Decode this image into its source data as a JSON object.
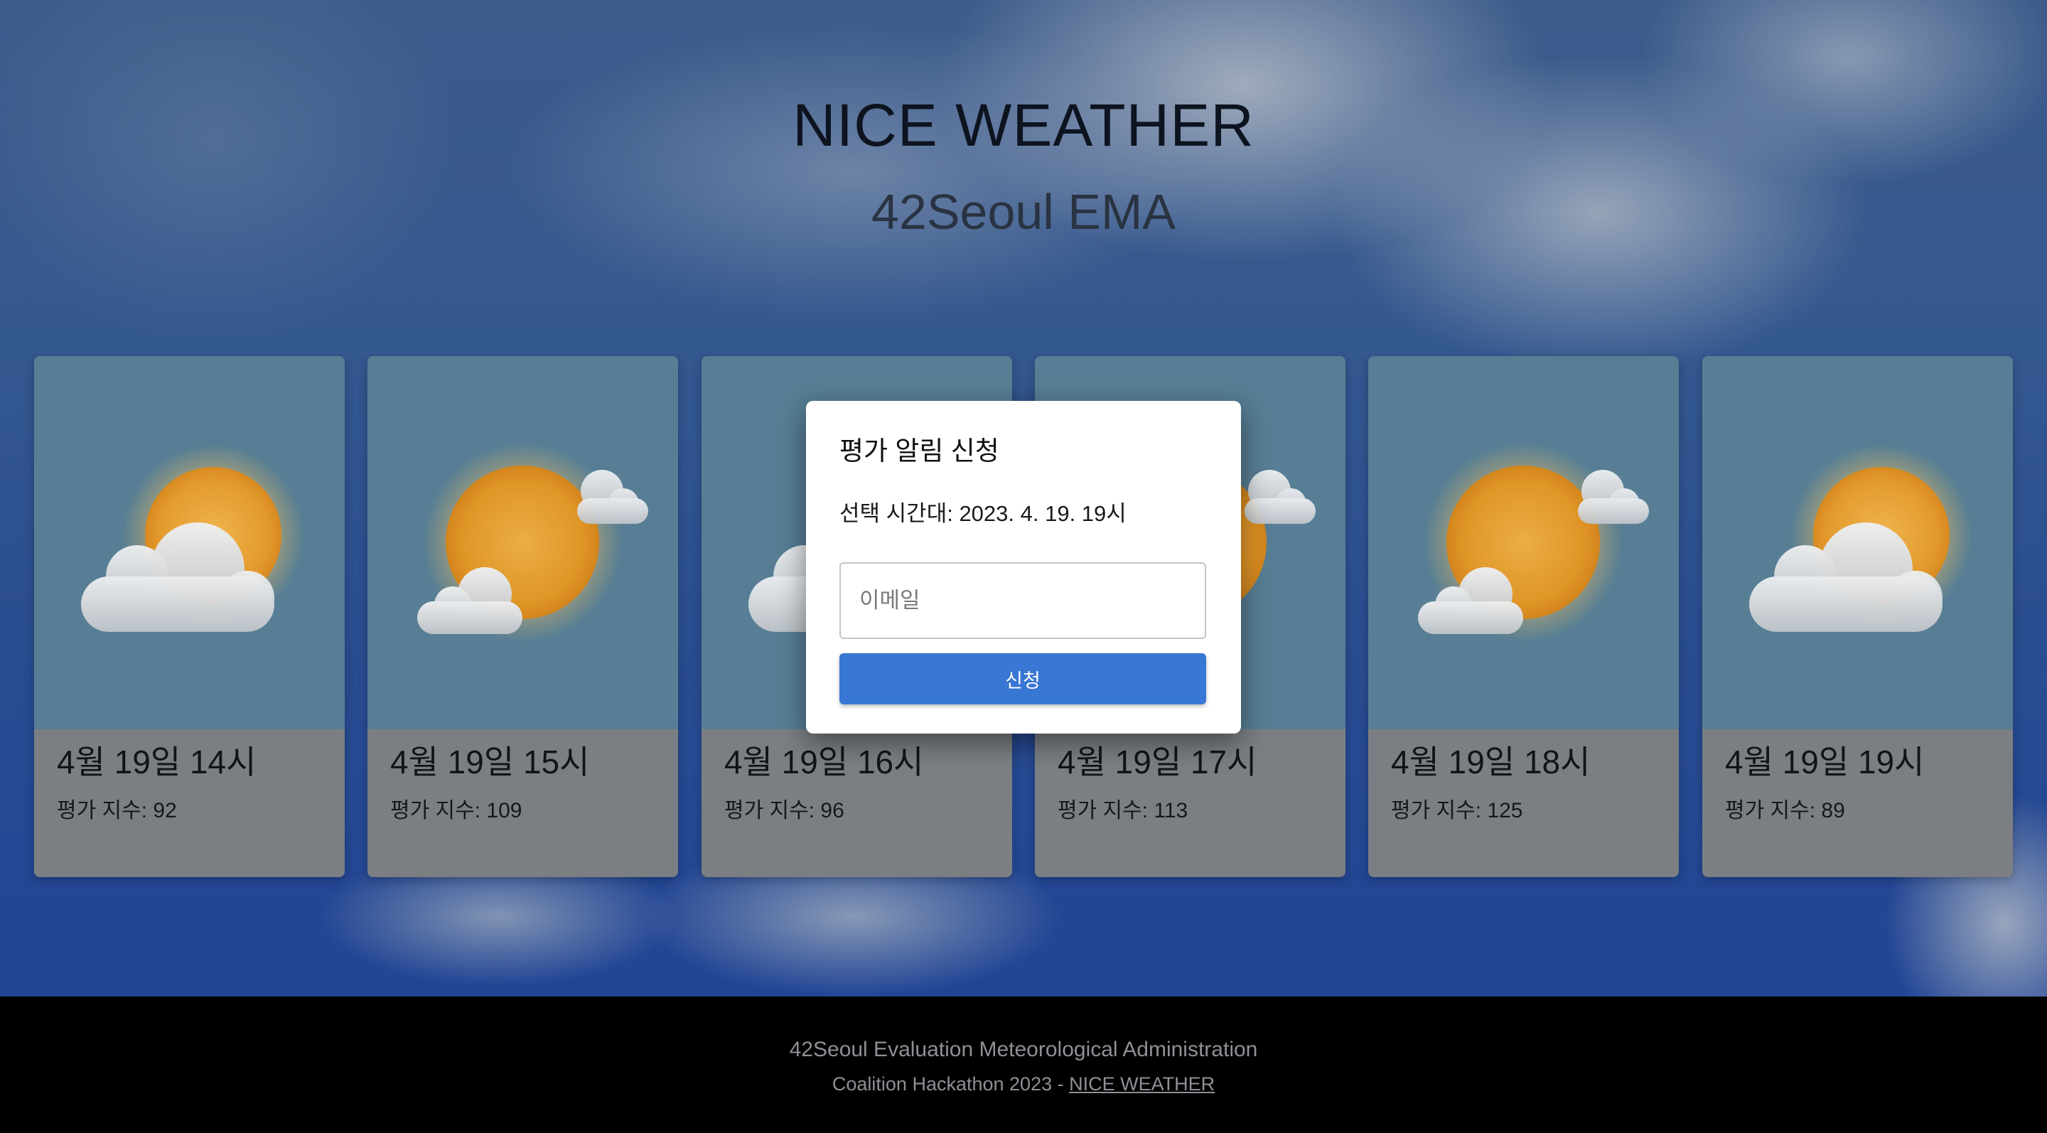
{
  "header": {
    "title": "NICE WEATHER",
    "subtitle": "42Seoul EMA"
  },
  "cards": [
    {
      "time": "4월 19일 14시",
      "score": "평가 지수: 92",
      "icon": "sun-behind-large-cloud-icon"
    },
    {
      "time": "4월 19일 15시",
      "score": "평가 지수: 109",
      "icon": "sun-behind-small-cloud-icon"
    },
    {
      "time": "4월 19일 16시",
      "score": "평가 지수: 96",
      "icon": "sun-behind-large-cloud-icon"
    },
    {
      "time": "4월 19일 17시",
      "score": "평가 지수: 113",
      "icon": "sun-behind-small-cloud-icon"
    },
    {
      "time": "4월 19일 18시",
      "score": "평가 지수: 125",
      "icon": "sun-behind-small-cloud-icon"
    },
    {
      "time": "4월 19일 19시",
      "score": "평가 지수: 89",
      "icon": "sun-behind-large-cloud-icon"
    }
  ],
  "modal": {
    "title": "평가 알림 신청",
    "selected_time": "선택 시간대: 2023. 4. 19. 19시",
    "email_value": "",
    "email_placeholder": "이메일",
    "submit_label": "신청"
  },
  "footer": {
    "line1": "42Seoul Evaluation Meteorological Administration",
    "line2_prefix": "Coalition Hackathon 2023 - ",
    "line2_link": "NICE WEATHER"
  },
  "colors": {
    "button": "#3877d3",
    "card_media": "#577e94",
    "card_body": "#7b7f83",
    "sun": "#e8a33a",
    "footer_bg": "#000000"
  }
}
